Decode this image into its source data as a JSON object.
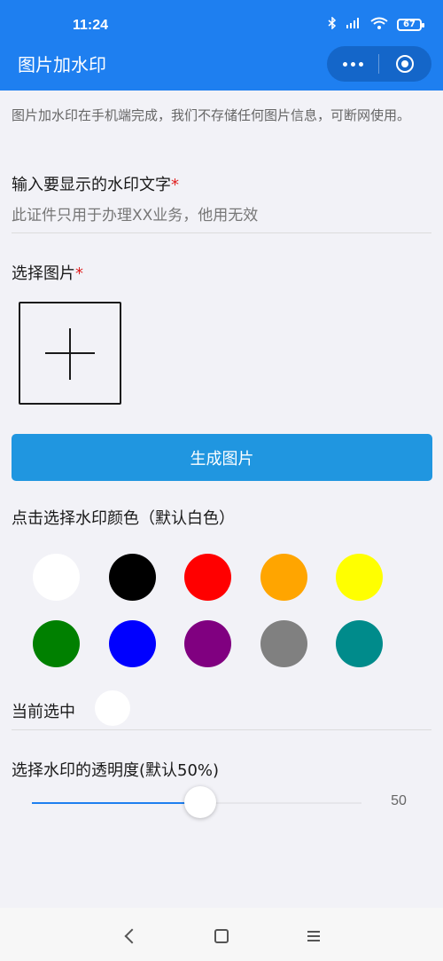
{
  "status_bar": {
    "time": "11:24",
    "icons": [
      "bluetooth-icon",
      "signal-icon",
      "wifi-icon",
      "battery-icon"
    ],
    "battery_level": "67"
  },
  "nav": {
    "title": "图片加水印",
    "more_icon": "more-dots-icon",
    "close_icon": "close-target-icon"
  },
  "intro_text": "图片加水印在手机端完成，我们不存储任何图片信息，可断网使用。",
  "watermark_text": {
    "label": "输入要显示的水印文字",
    "required_mark": "*",
    "placeholder": "此证件只用于办理XX业务，他用无效",
    "value": ""
  },
  "image_select": {
    "label": "选择图片",
    "required_mark": "*"
  },
  "generate_button": "生成图片",
  "color_picker": {
    "label": "点击选择水印颜色（默认白色）",
    "colors": [
      "#ffffff",
      "#000000",
      "#ff0000",
      "#ffa500",
      "#ffff00",
      "#008000",
      "#0000ff",
      "#800080",
      "#808080",
      "#008b8b"
    ],
    "current_label": "当前选中",
    "current_color": "#ffffff"
  },
  "opacity": {
    "label": "选择水印的透明度(默认50%)",
    "value": "50",
    "fraction": 0.5
  },
  "accent_colors": {
    "header": "#1e7ff0",
    "button": "#2096e0",
    "required": "#e02020"
  },
  "system_nav": [
    "back-icon",
    "home-icon",
    "menu-icon"
  ]
}
